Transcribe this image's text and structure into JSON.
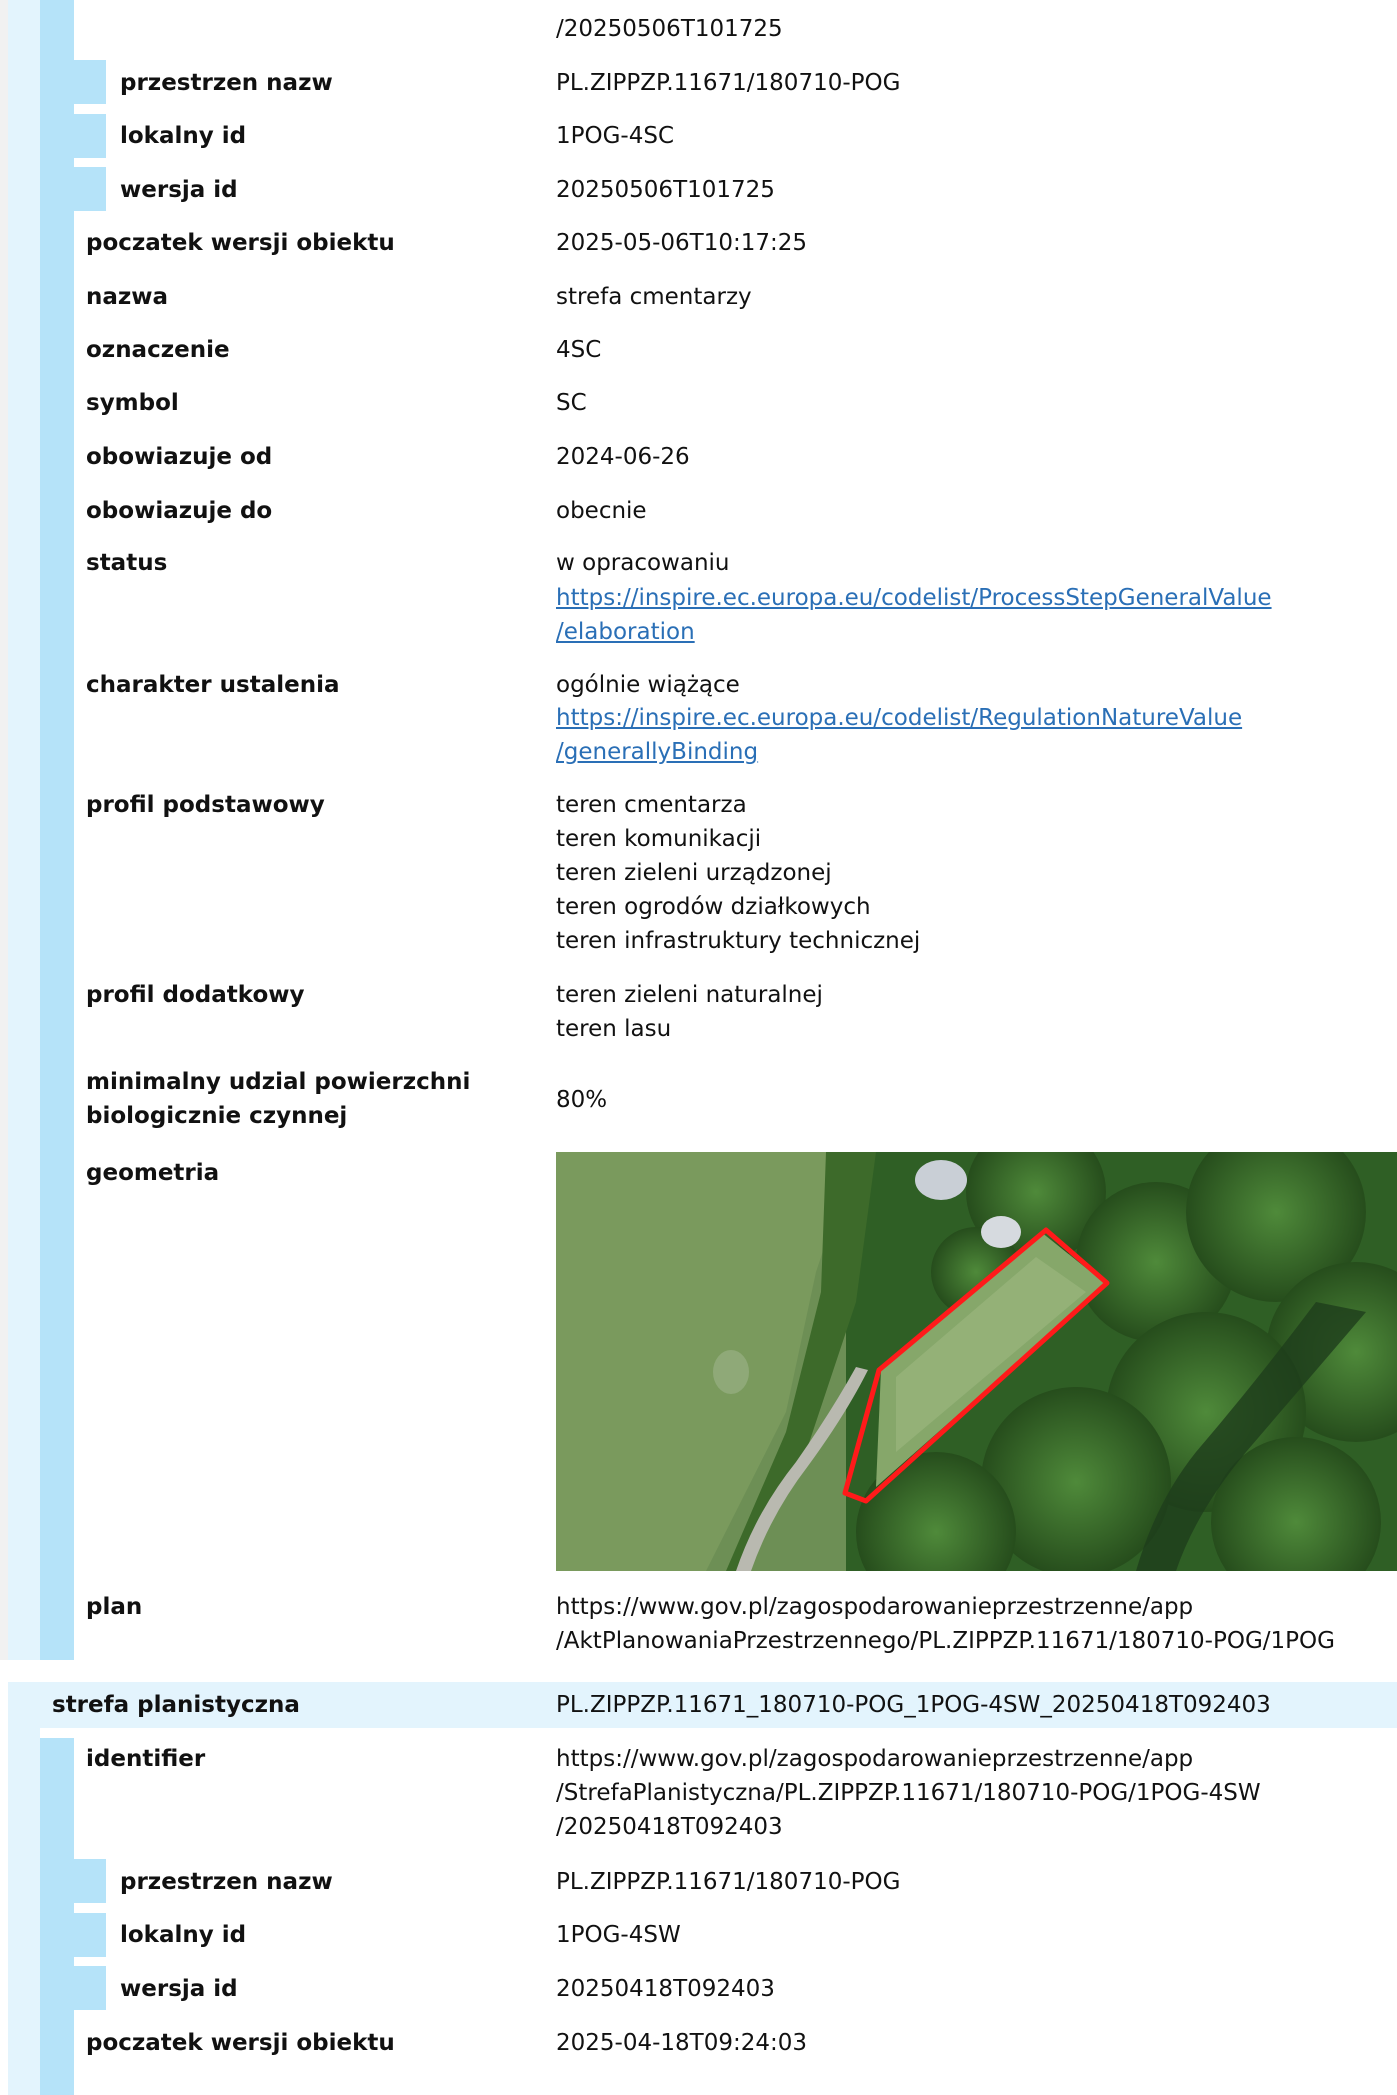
{
  "section1": {
    "identifier_tail": "/20250506T101725",
    "przestrzen_nazw": {
      "label": "przestrzen nazw",
      "value": "PL.ZIPPZP.11671/180710-POG"
    },
    "lokalny_id": {
      "label": "lokalny id",
      "value": "1POG-4SC"
    },
    "wersja_id": {
      "label": "wersja id",
      "value": "20250506T101725"
    },
    "poczatek": {
      "label": "poczatek wersji obiektu",
      "value": "2025-05-06T10:17:25"
    },
    "nazwa": {
      "label": "nazwa",
      "value": "strefa cmentarzy"
    },
    "oznaczenie": {
      "label": "oznaczenie",
      "value": "4SC"
    },
    "symbol": {
      "label": "symbol",
      "value": "SC"
    },
    "obowiazuje_od": {
      "label": "obowiazuje od",
      "value": "2024-06-26"
    },
    "obowiazuje_do": {
      "label": "obowiazuje do",
      "value": "obecnie"
    },
    "status": {
      "label": "status",
      "value": "w opracowaniu",
      "link_line1": "https://inspire.ec.europa.eu/codelist/ProcessStepGeneralValue",
      "link_line2": "/elaboration"
    },
    "charakter": {
      "label": "charakter ustalenia",
      "value": "ogólnie wiążące",
      "link_line1": "https://inspire.ec.europa.eu/codelist/RegulationNatureValue",
      "link_line2": "/generallyBinding"
    },
    "profil_podstawowy": {
      "label": "profil podstawowy",
      "values": [
        "teren cmentarza",
        "teren komunikacji",
        "teren zieleni urządzonej",
        "teren ogrodów działkowych",
        "teren infrastruktury technicznej"
      ]
    },
    "profil_dodatkowy": {
      "label": "profil dodatkowy",
      "values": [
        "teren zieleni naturalnej",
        "teren lasu"
      ]
    },
    "min_udzial": {
      "label_line1": "minimalny udzial powierzchni",
      "label_line2": "biologicznie czynnej",
      "value": "80%"
    },
    "geometria": {
      "label": "geometria"
    },
    "plan": {
      "label": "plan",
      "value_line1": "https://www.gov.pl/zagospodarowanieprzestrzenne/app",
      "value_line2": "/AktPlanowaniaPrzestrzennego/PL.ZIPPZP.11671/180710-POG/1POG"
    }
  },
  "section2": {
    "header": {
      "label": "strefa planistyczna",
      "value": "PL.ZIPPZP.11671_180710-POG_1POG-4SW_20250418T092403"
    },
    "identifier": {
      "label": "identifier",
      "value_line1": "https://www.gov.pl/zagospodarowanieprzestrzenne/app",
      "value_line2": "/StrefaPlanistyczna/PL.ZIPPZP.11671/180710-POG/1POG-4SW",
      "value_line3": "/20250418T092403"
    },
    "przestrzen_nazw": {
      "label": "przestrzen nazw",
      "value": "PL.ZIPPZP.11671/180710-POG"
    },
    "lokalny_id": {
      "label": "lokalny id",
      "value": "1POG-4SW"
    },
    "wersja_id": {
      "label": "wersja id",
      "value": "20250418T092403"
    },
    "poczatek": {
      "label": "poczatek wersji obiektu",
      "value": "2025-04-18T09:24:03"
    }
  },
  "colors": {
    "level1": "#e3f4fd",
    "level2": "#b5e3f9",
    "outer": "#f1f1f1",
    "link": "#2a6fb6",
    "boundary": "#ff1a1a"
  }
}
